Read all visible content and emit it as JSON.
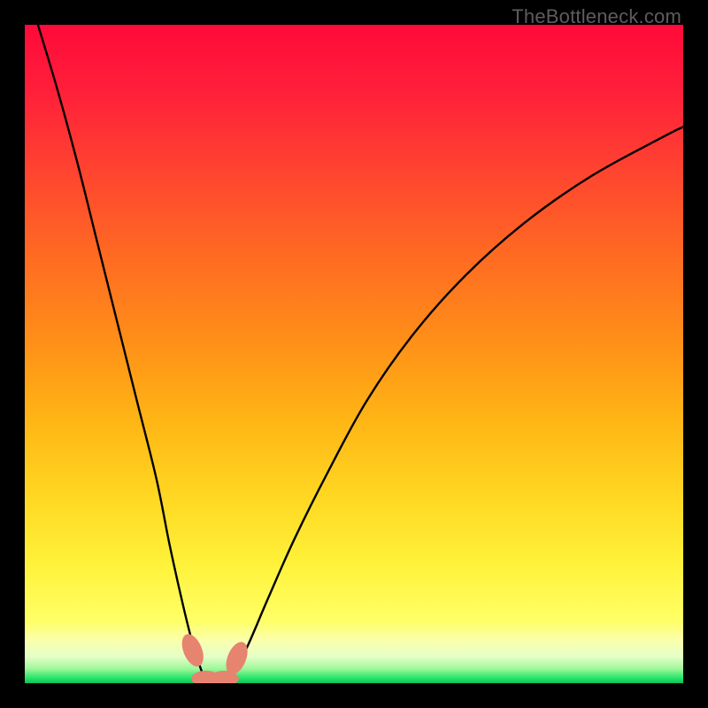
{
  "watermark": "TheBottleneck.com",
  "chart_data": {
    "type": "line",
    "title": "",
    "xlabel": "",
    "ylabel": "",
    "xlim": [
      0,
      100
    ],
    "ylim": [
      0,
      100
    ],
    "grid": false,
    "legend": false,
    "series": [
      {
        "name": "curve-left",
        "x": [
          2,
          5,
          8,
          11,
          14,
          17,
          20,
          22,
          24,
          25.5,
          26.8,
          27.5
        ],
        "values": [
          100,
          90,
          79,
          67,
          55,
          43,
          31,
          21,
          12,
          6,
          2,
          0.5
        ]
      },
      {
        "name": "curve-right",
        "x": [
          30.5,
          32,
          34,
          37,
          41,
          46,
          52,
          59,
          67,
          76,
          86,
          97,
          100
        ],
        "values": [
          0.5,
          2,
          6,
          13,
          22,
          32,
          43,
          53,
          62,
          70,
          77,
          83,
          84.5
        ]
      }
    ],
    "markers": [
      {
        "name": "dot-left-upper",
        "x": 25.5,
        "y": 5,
        "rx": 1.4,
        "ry": 2.6,
        "angle": -22
      },
      {
        "name": "dot-left-mid",
        "x": 27.5,
        "y": 0.7,
        "rx": 2.2,
        "ry": 1.2,
        "angle": 0
      },
      {
        "name": "dot-right-mid",
        "x": 30.3,
        "y": 0.7,
        "rx": 2.2,
        "ry": 1.2,
        "angle": 0
      },
      {
        "name": "dot-right-upper",
        "x": 32.2,
        "y": 3.8,
        "rx": 1.4,
        "ry": 2.6,
        "angle": 22
      }
    ],
    "gradient_stops": [
      {
        "offset": 0.0,
        "color": "#ff0a3a"
      },
      {
        "offset": 0.1,
        "color": "#ff1f3a"
      },
      {
        "offset": 0.22,
        "color": "#ff4330"
      },
      {
        "offset": 0.35,
        "color": "#ff6a22"
      },
      {
        "offset": 0.48,
        "color": "#ff8f18"
      },
      {
        "offset": 0.6,
        "color": "#ffb515"
      },
      {
        "offset": 0.72,
        "color": "#ffd822"
      },
      {
        "offset": 0.82,
        "color": "#fff23a"
      },
      {
        "offset": 0.905,
        "color": "#ffff66"
      },
      {
        "offset": 0.935,
        "color": "#fbffad"
      },
      {
        "offset": 0.96,
        "color": "#e4ffc7"
      },
      {
        "offset": 0.978,
        "color": "#9ff79a"
      },
      {
        "offset": 0.992,
        "color": "#27e56a"
      },
      {
        "offset": 1.0,
        "color": "#0fbf55"
      }
    ],
    "marker_color": "#e6846f",
    "curve_color": "#000000"
  }
}
